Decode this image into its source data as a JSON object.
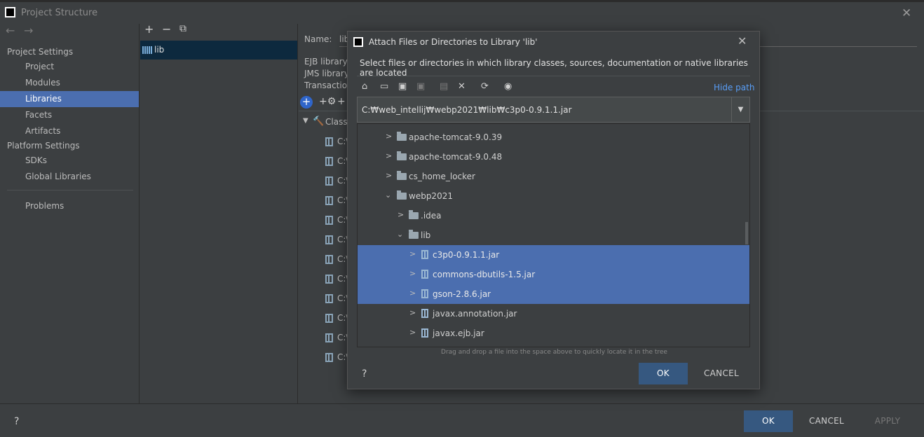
{
  "window": {
    "title": "Project Structure",
    "close_glyph": "✕"
  },
  "nav": {
    "back": "←",
    "forward": "→"
  },
  "sidebar": {
    "project_settings": "Project Settings",
    "project": "Project",
    "modules": "Modules",
    "libraries": "Libraries",
    "facets": "Facets",
    "artifacts": "Artifacts",
    "platform_settings": "Platform Settings",
    "sdks": "SDKs",
    "global_libraries": "Global Libraries",
    "problems": "Problems"
  },
  "libraries_panel": {
    "add": "+",
    "remove": "−",
    "copy": "⧉",
    "items": [
      {
        "label": "lib"
      }
    ]
  },
  "detail": {
    "name_label": "Name:",
    "name_value": "lib",
    "rows": [
      "EJB library",
      "JMS library",
      "Transaction"
    ],
    "classes_label": "Classe",
    "class_entry_prefix": "C:\\"
  },
  "dialog": {
    "title": "Attach Files or Directories to Library 'lib'",
    "close_glyph": "✕",
    "description": "Select files or directories in which library classes, sources, documentation or native libraries are located",
    "hide_path": "Hide path",
    "path_value": "C:₩web_intellij₩webp2021₩lib₩c3p0-0.9.1.1.jar",
    "tree": [
      {
        "label": "apache-tomcat-9.0.39",
        "type": "folder",
        "expanded": false,
        "selected": false
      },
      {
        "label": "apache-tomcat-9.0.48",
        "type": "folder",
        "expanded": false,
        "selected": false
      },
      {
        "label": "cs_home_locker",
        "type": "folder",
        "expanded": false,
        "selected": false
      },
      {
        "label": "webp2021",
        "type": "folder",
        "expanded": true,
        "selected": false
      },
      {
        "label": ".idea",
        "type": "folder",
        "expanded": false,
        "selected": false
      },
      {
        "label": "lib",
        "type": "folder",
        "expanded": true,
        "selected": false
      },
      {
        "label": "c3p0-0.9.1.1.jar",
        "type": "jar",
        "expanded": false,
        "selected": true
      },
      {
        "label": "commons-dbutils-1.5.jar",
        "type": "jar",
        "expanded": false,
        "selected": true
      },
      {
        "label": "gson-2.8.6.jar",
        "type": "jar",
        "expanded": false,
        "selected": true
      },
      {
        "label": "javax.annotation.jar",
        "type": "jar",
        "expanded": false,
        "selected": false
      },
      {
        "label": "javax.ejb.jar",
        "type": "jar",
        "expanded": false,
        "selected": false
      }
    ],
    "drag_hint": "Drag and drop a file into the space above to quickly locate it in the tree",
    "help": "?",
    "ok": "OK",
    "cancel": "CANCEL"
  },
  "footer": {
    "help": "?",
    "ok": "OK",
    "cancel": "CANCEL",
    "apply": "APPLY"
  },
  "colors": {
    "selection": "#4b6eaf",
    "primary_button": "#365880",
    "link": "#589df6"
  }
}
